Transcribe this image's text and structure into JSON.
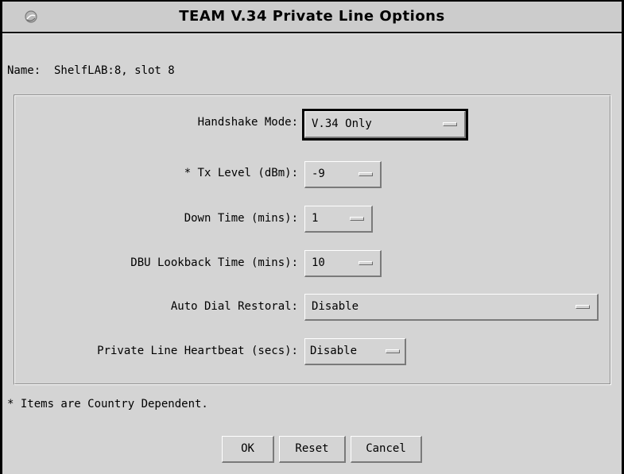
{
  "window": {
    "title": "TEAM V.34 Private Line Options",
    "menu_icon": "window-menu-icon"
  },
  "name_line": "Name:  ShelfLAB:8, slot 8",
  "fields": {
    "handshake_mode": {
      "label": "Handshake Mode:",
      "value": "V.34 Only"
    },
    "tx_level": {
      "label": "* Tx Level (dBm):",
      "value": "-9"
    },
    "down_time": {
      "label": "Down Time (mins):",
      "value": "1"
    },
    "dbu_lookback": {
      "label": "DBU Lookback Time (mins):",
      "value": "10"
    },
    "auto_dial_restoral": {
      "label": "Auto Dial Restoral:",
      "value": "Disable"
    },
    "heartbeat": {
      "label": "Private Line Heartbeat (secs):",
      "value": "Disable"
    }
  },
  "footnote": "* Items are Country Dependent.",
  "buttons": {
    "ok": "OK",
    "reset": "Reset",
    "cancel": "Cancel"
  },
  "colors": {
    "dialog_bg": "#d4d4d4",
    "titlebar_bg": "#cccccc",
    "frame": "#000000"
  }
}
